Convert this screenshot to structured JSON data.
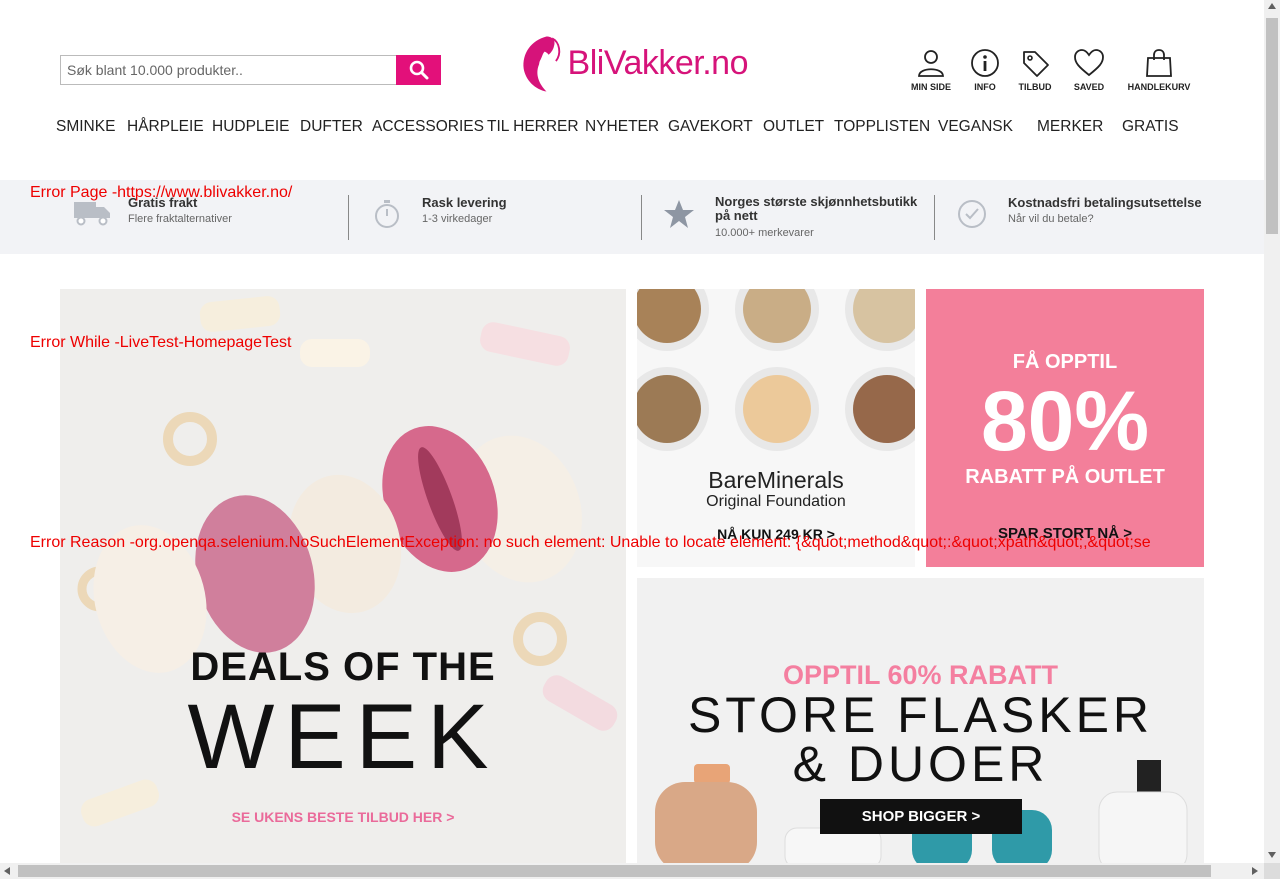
{
  "search": {
    "placeholder": "Søk blant 10.000 produkter.."
  },
  "logo": {
    "text": "BliVakker.no"
  },
  "top_icons": [
    "MIN SIDE",
    "INFO",
    "TILBUD",
    "SAVED",
    "HANDLEKURV"
  ],
  "nav": [
    "SMINKE",
    "HÅRPLEIE",
    "HUDPLEIE",
    "DUFTER",
    "ACCESSORIES",
    "TIL HERRER",
    "NYHETER",
    "GAVEKORT",
    "OUTLET",
    "TOPPLISTEN",
    "VEGANSK",
    "MERKER",
    "GRATIS"
  ],
  "usp": [
    {
      "title": "Gratis frakt",
      "sub": "Flere fraktalternativer",
      "icon": "truck-icon"
    },
    {
      "title": "Rask levering",
      "sub": "1-3 virkedager",
      "icon": "stopwatch-icon"
    },
    {
      "title": "Norges største skjønnhetsbutikk på nett",
      "sub": "10.000+ merkevarer",
      "icon": "star-icon"
    },
    {
      "title": "Kostnadsfri betalingsutsettelse",
      "sub": "Når vil du betale?",
      "icon": "check-circle-icon"
    }
  ],
  "banners": {
    "deals": {
      "line1": "DEALS OF THE",
      "line2": "WEEK",
      "cta": "SE UKENS BESTE TILBUD HER >"
    },
    "bare": {
      "brand": "BareMinerals",
      "product": "Original Foundation",
      "cta": "NÅ KUN 249 KR >"
    },
    "outlet": {
      "top": "FÅ OPPTIL",
      "big": "80%",
      "sub": "RABATT PÅ OUTLET",
      "cta": "SPAR STORT NÅ >"
    },
    "bigger": {
      "top": "OPPTIL 60% RABATT",
      "line1": "STORE FLASKER",
      "line2": "& DUOER",
      "cta": "SHOP BIGGER >"
    }
  },
  "errors": {
    "page": "Error Page -https://www.blivakker.no/",
    "while": "Error While -LiveTest-HomepageTest",
    "reason": "Error Reason -org.openqa.selenium.NoSuchElementException: no such element: Unable to locate element: {&quot;method&quot;:&quot;xpath&quot;,&quot;se"
  },
  "colors": {
    "accent": "#e3107a",
    "outlet_bg": "#f37f9a",
    "error": "#e00000"
  }
}
